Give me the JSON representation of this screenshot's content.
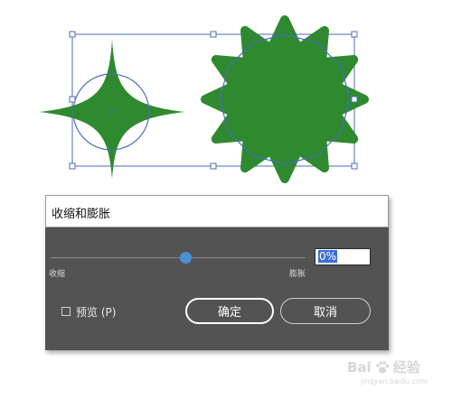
{
  "colors": {
    "shape_fill": "#2f8a2f",
    "selection_outline": "#4a6bbf",
    "dialog_bg": "#535353",
    "slider_thumb": "#4a90d6"
  },
  "dialog": {
    "title": "收缩和膨胀",
    "slider": {
      "value_fraction": 0.5
    },
    "value_input": {
      "value": "0%"
    },
    "label_shrink": "收缩",
    "label_expand": "膨胀",
    "preview": {
      "checked": false,
      "label": "预览 (P)"
    },
    "ok_label": "确定",
    "cancel_label": "取消"
  },
  "watermark": {
    "brand_left": "Bai",
    "brand_right": "经验",
    "logo_icon": "paw-icon",
    "domain": "jingyan.baidu.com"
  }
}
